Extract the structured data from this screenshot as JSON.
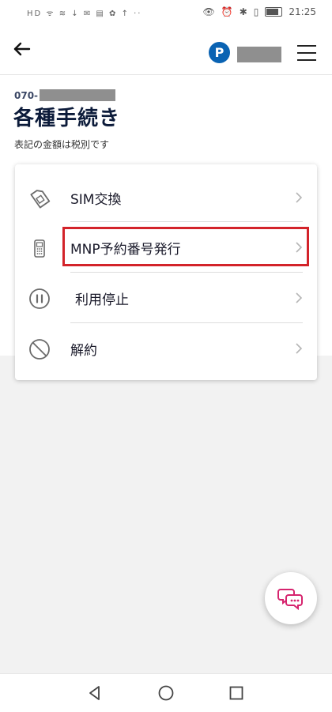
{
  "status_bar": {
    "left_indicators": "HD ᯤ ≋ ↓ ✉ ▤ ✿ ↑ ··",
    "time": "21:25",
    "battery_level": 0.75
  },
  "header": {
    "back_icon": "arrow-left-icon",
    "points_badge": "P",
    "menu_icon": "hamburger-menu-icon"
  },
  "account": {
    "phone_prefix": "070-"
  },
  "page": {
    "title": "各種手続き",
    "note": "表記の金額は税別です"
  },
  "menu_items": [
    {
      "label": "SIM交換",
      "icon": "sim-card-icon"
    },
    {
      "label": "MNP予約番号発行",
      "icon": "mobile-phone-icon"
    },
    {
      "label": "利用停止",
      "icon": "pause-icon"
    },
    {
      "label": "解約",
      "icon": "cancel-icon"
    }
  ],
  "highlight_color": "#d3232a",
  "chat_fab": {
    "icon": "chat-bubbles-icon",
    "color": "#d6246e"
  },
  "nav_bar": {
    "back": "triangle-back-icon",
    "home": "circle-home-icon",
    "recents": "square-recents-icon"
  }
}
